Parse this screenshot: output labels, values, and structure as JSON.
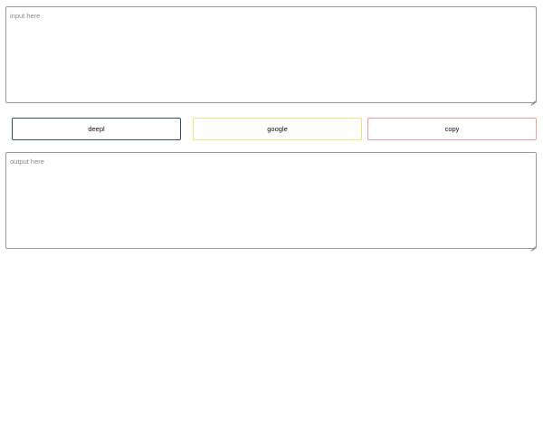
{
  "input": {
    "placeholder": "input here",
    "value": ""
  },
  "buttons": {
    "deepl_label": "deepl",
    "google_label": "google",
    "copy_label": "copy"
  },
  "output": {
    "placeholder": "output here",
    "value": ""
  },
  "colors": {
    "deepl_border": "#2c4e70",
    "google_border": "#f6e27a",
    "copy_border": "#f29b9b",
    "textarea_border": "#9a9a9a"
  }
}
